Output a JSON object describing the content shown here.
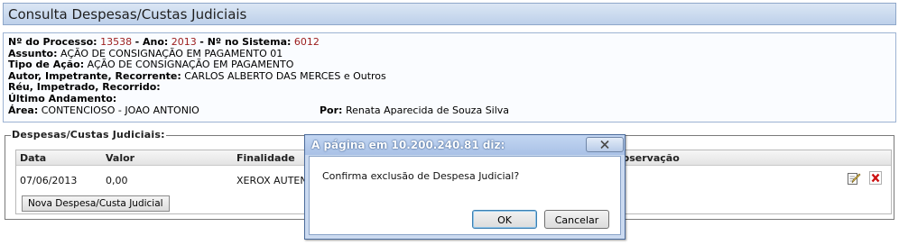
{
  "page": {
    "title": "Consulta Despesas/Custas Judiciais"
  },
  "processo": {
    "numero_label": "Nº do Processo:",
    "numero": "13538",
    "ano_label": "Ano:",
    "ano": "2013",
    "sistema_label": "Nº no Sistema:",
    "sistema": "6012",
    "assunto_label": "Assunto:",
    "assunto": "AÇÃO DE CONSIGNAÇÃO EM PAGAMENTO 01",
    "tipo_label": "Tipo de Ação:",
    "tipo": "AÇÃO DE CONSIGNAÇÃO EM PAGAMENTO",
    "autor_label": "Autor, Impetrante, Recorrente:",
    "autor": "CARLOS ALBERTO DAS MERCES e Outros",
    "reu_label": "Réu, Impetrado, Recorrido:",
    "andamento_label": "Último Andamento:",
    "area_label": "Área:",
    "area": "CONTENCIOSO - JOAO ANTONIO",
    "por_label": "Por:",
    "por": "Renata Aparecida de Souza Silva"
  },
  "despesas": {
    "legend": "Despesas/Custas Judiciais:",
    "columns": {
      "data": "Data",
      "valor": "Valor",
      "finalidade": "Finalidade",
      "observacao": "Observação"
    },
    "rows": [
      {
        "data": "07/06/2013",
        "valor": "0,00",
        "finalidade": "XEROX AUTEN"
      }
    ],
    "new_button": "Nova Despesa/Custa Judicial"
  },
  "dialog": {
    "title": "A página em 10.200.240.81 diz:",
    "message": "Confirma exclusão de Despesa Judicial?",
    "ok": "OK",
    "cancel": "Cancelar"
  },
  "colors": {
    "title_bar": "#bdd0ea",
    "highlight_red": "#9b1c1c",
    "delete_icon": "#cc1111"
  }
}
